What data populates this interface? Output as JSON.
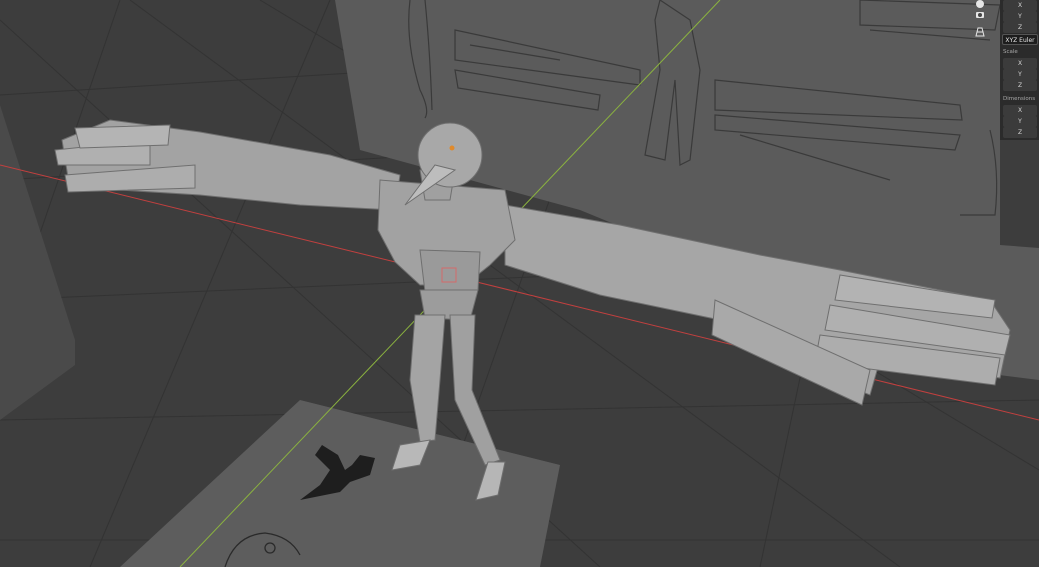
{
  "app": "Blender",
  "viewport": {
    "mode": "3d-viewport",
    "axes": {
      "x_axis_color": "#c2403f",
      "y_axis_color": "#8bb33f"
    },
    "grid_visible": true,
    "background": "#3d3d3d"
  },
  "nav_icons": [
    "orbit-gizmo-icon",
    "camera-icon",
    "grid-toggle-icon"
  ],
  "transform_panel": {
    "rotation": {
      "x_label": "X",
      "y_label": "Y",
      "z_label": "Z",
      "mode": "XYZ Euler"
    },
    "scale": {
      "header": "Scale",
      "x_label": "X",
      "y_label": "Y",
      "z_label": "Z"
    },
    "dimensions": {
      "header": "Dimensions",
      "x_label": "X",
      "y_label": "Y",
      "z_label": "Z"
    }
  },
  "colors": {
    "model": "#9c9c9c",
    "reference_plane": "#5a5a5a",
    "selection_origin": "#e08a2c"
  }
}
